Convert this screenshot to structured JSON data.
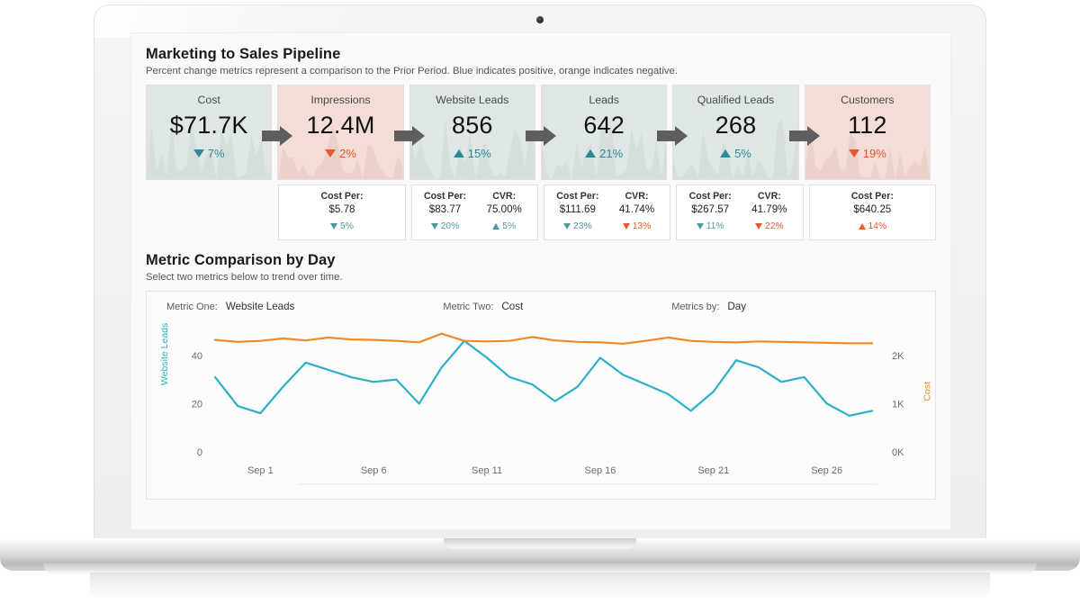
{
  "pipeline": {
    "title": "Marketing to Sales Pipeline",
    "subtitle": "Percent change metrics represent a comparison to the Prior Period. Blue indicates positive, orange indicates negative.",
    "cards": [
      {
        "label": "Cost",
        "value": "$71.7K",
        "delta": "7%",
        "dir": "down",
        "tone": "pos",
        "bg": "cool"
      },
      {
        "label": "Impressions",
        "value": "12.4M",
        "delta": "2%",
        "dir": "down",
        "tone": "neg",
        "bg": "warm"
      },
      {
        "label": "Website Leads",
        "value": "856",
        "delta": "15%",
        "dir": "up",
        "tone": "pos",
        "bg": "cool"
      },
      {
        "label": "Leads",
        "value": "642",
        "delta": "21%",
        "dir": "up",
        "tone": "pos",
        "bg": "cool"
      },
      {
        "label": "Qualified Leads",
        "value": "268",
        "delta": "5%",
        "dir": "up",
        "tone": "pos",
        "bg": "cool"
      },
      {
        "label": "Customers",
        "value": "112",
        "delta": "19%",
        "dir": "down",
        "tone": "neg",
        "bg": "warm"
      }
    ],
    "sub_cards": [
      {
        "empty": true
      },
      {
        "metrics": [
          {
            "name": "Cost Per:",
            "value": "$5.78",
            "delta": "5%",
            "dir": "down",
            "tone": "pos"
          }
        ]
      },
      {
        "metrics": [
          {
            "name": "Cost Per:",
            "value": "$83.77",
            "delta": "20%",
            "dir": "down",
            "tone": "pos"
          },
          {
            "name": "CVR:",
            "value": "75.00%",
            "delta": "5%",
            "dir": "up",
            "tone": "pos"
          }
        ]
      },
      {
        "metrics": [
          {
            "name": "Cost Per:",
            "value": "$111.69",
            "delta": "23%",
            "dir": "down",
            "tone": "pos"
          },
          {
            "name": "CVR:",
            "value": "41.74%",
            "delta": "13%",
            "dir": "down",
            "tone": "neg"
          }
        ]
      },
      {
        "metrics": [
          {
            "name": "Cost Per:",
            "value": "$267.57",
            "delta": "11%",
            "dir": "down",
            "tone": "pos"
          },
          {
            "name": "CVR:",
            "value": "41.79%",
            "delta": "22%",
            "dir": "down",
            "tone": "neg"
          }
        ]
      },
      {
        "metrics": [
          {
            "name": "Cost Per:",
            "value": "$640.25",
            "delta": "14%",
            "dir": "up",
            "tone": "neg"
          }
        ]
      }
    ]
  },
  "comparison": {
    "title": "Metric Comparison by Day",
    "subtitle": "Select two metrics below to trend over time.",
    "controls": [
      {
        "label": "Metric One:",
        "value": "Website Leads"
      },
      {
        "label": "Metric Two:",
        "value": "Cost"
      },
      {
        "label": "Metrics by:",
        "value": "Day"
      }
    ]
  },
  "colors": {
    "teal": "#2cb0c8",
    "orange": "#f08a28",
    "positive": "#2b8a96",
    "negative": "#e8592a",
    "card_cool": "#dfe6e6",
    "card_warm": "#f3ddd6"
  },
  "chart_data": {
    "type": "line",
    "title": "Metric Comparison by Day",
    "xlabel": "",
    "x": [
      "Aug 30",
      "Aug 31",
      "Sep 1",
      "Sep 2",
      "Sep 3",
      "Sep 4",
      "Sep 5",
      "Sep 6",
      "Sep 7",
      "Sep 8",
      "Sep 9",
      "Sep 10",
      "Sep 11",
      "Sep 12",
      "Sep 13",
      "Sep 14",
      "Sep 15",
      "Sep 16",
      "Sep 17",
      "Sep 18",
      "Sep 19",
      "Sep 20",
      "Sep 21",
      "Sep 22",
      "Sep 23",
      "Sep 24",
      "Sep 25",
      "Sep 26",
      "Sep 27",
      "Sep 28"
    ],
    "xticks": [
      "Sep 1",
      "Sep 6",
      "Sep 11",
      "Sep 16",
      "Sep 21",
      "Sep 26"
    ],
    "grid": false,
    "legend": "none",
    "series": [
      {
        "name": "Website Leads",
        "axis": "left",
        "color": "#2cb0c8",
        "ylabel": "Website Leads",
        "ylim": [
          0,
          50
        ],
        "yticks": [
          0,
          20,
          40
        ],
        "values": [
          31,
          19,
          16,
          27,
          37,
          34,
          31,
          29,
          30,
          20,
          35,
          46,
          39,
          31,
          28,
          21,
          27,
          39,
          32,
          28,
          24,
          17,
          25,
          38,
          35,
          29,
          31,
          20,
          15,
          17
        ]
      },
      {
        "name": "Cost",
        "axis": "right",
        "color": "#f08a28",
        "ylabel": "Cost",
        "ylim": [
          0,
          2500
        ],
        "yticks": [
          0,
          1000,
          2000
        ],
        "ytick_labels": [
          "0K",
          "1K",
          "2K"
        ],
        "values": [
          2320,
          2280,
          2300,
          2350,
          2310,
          2370,
          2330,
          2320,
          2300,
          2270,
          2450,
          2300,
          2290,
          2300,
          2380,
          2310,
          2280,
          2270,
          2240,
          2300,
          2370,
          2300,
          2280,
          2270,
          2290,
          2280,
          2270,
          2260,
          2250,
          2250
        ]
      }
    ]
  }
}
